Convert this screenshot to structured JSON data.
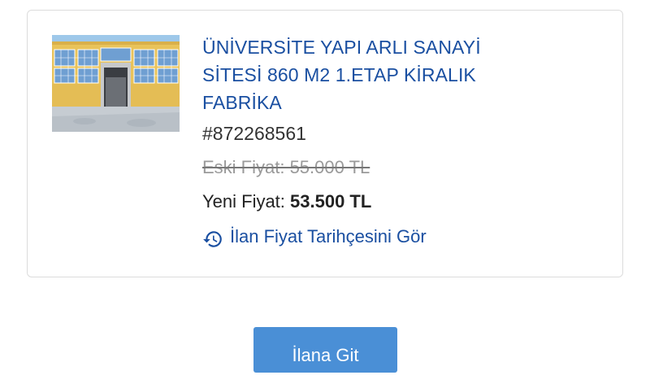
{
  "listing": {
    "title_lines": [
      "ÜNİVERSİTE YAPI ARLI SANAYİ",
      "SİTESİ 860 M2 1.ETAP KİRALIK",
      "FABRİKA"
    ],
    "listing_id": "#872268561",
    "old_price": "Eski Fiyat: 55.000 TL",
    "new_price_label": "Yeni Fiyat: ",
    "new_price_value": "53.500 TL",
    "history_link": "İlan Fiyat Tarihçesini Gör",
    "history_icon": "history-clock-icon",
    "thumbnail": "factory-building-photo"
  },
  "go_button_label": "İlana Git",
  "colors": {
    "link_blue": "#1a4fa1",
    "button_blue": "#4a8fd6",
    "border": "#dcdcdc"
  }
}
